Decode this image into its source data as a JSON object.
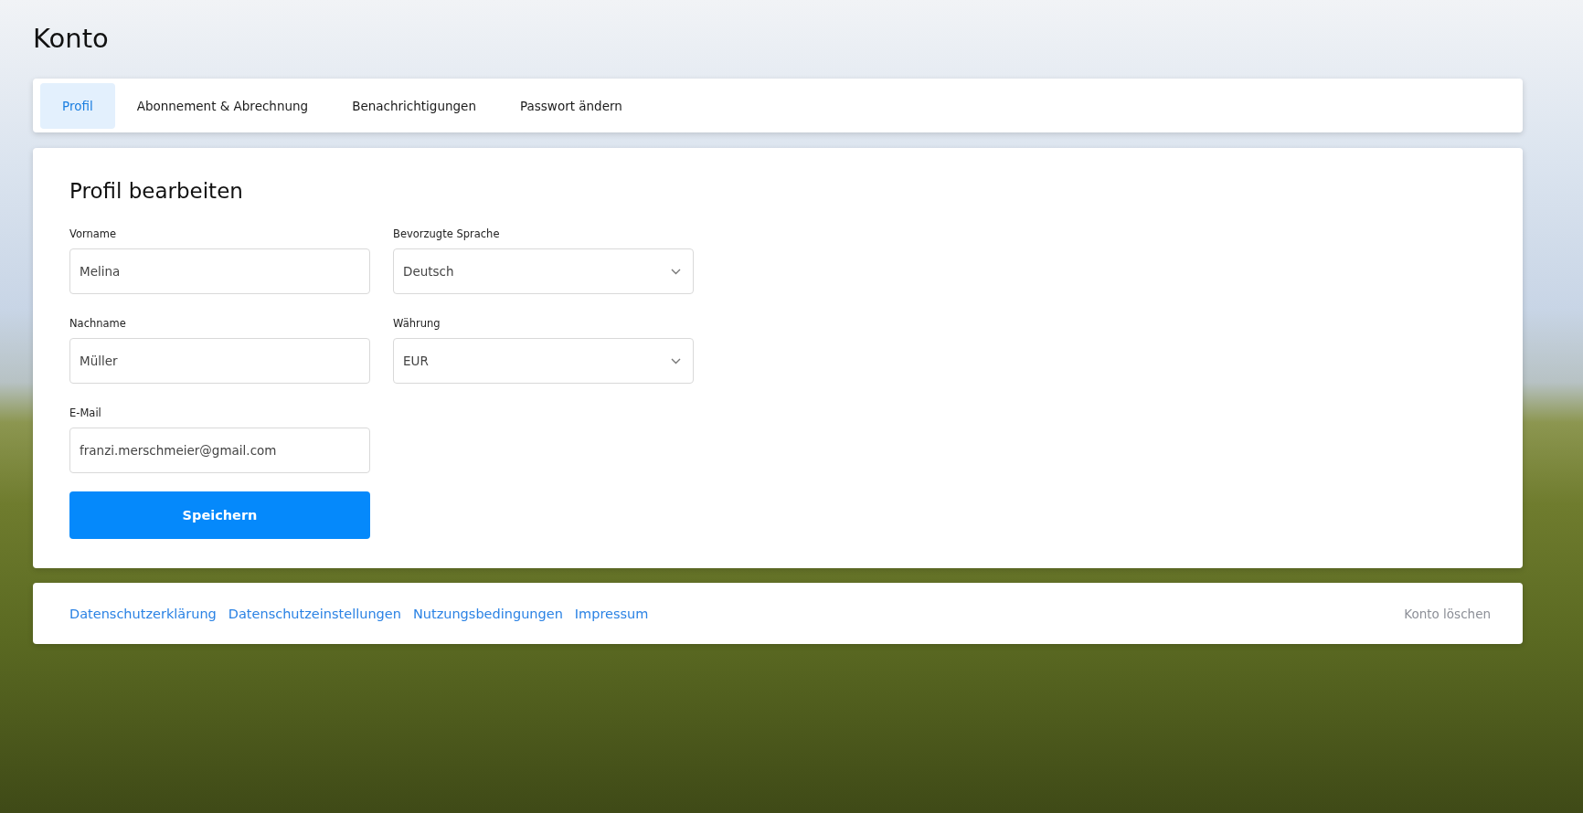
{
  "page": {
    "title": "Konto"
  },
  "tabs": [
    {
      "label": "Profil",
      "selected": true
    },
    {
      "label": "Abonnement & Abrechnung",
      "selected": false
    },
    {
      "label": "Benachrichtigungen",
      "selected": false
    },
    {
      "label": "Passwort ändern",
      "selected": false
    }
  ],
  "profile_form": {
    "title": "Profil bearbeiten",
    "fields": [
      {
        "label": "Vorname",
        "value": "Melina",
        "kind": "text"
      },
      {
        "label": "Bevorzugte Sprache",
        "value": "Deutsch",
        "kind": "select"
      },
      {
        "label": "Nachname",
        "value": "Müller",
        "kind": "text"
      },
      {
        "label": "Währung",
        "value": "EUR",
        "kind": "select"
      },
      {
        "label": "E-Mail",
        "value": "franzi.merschmeier@gmail.com",
        "kind": "text"
      }
    ],
    "save_button": "Speichern"
  },
  "footer": {
    "links": [
      "Datenschutzerklärung",
      "Datenschutzeinstellungen",
      "Nutzungsbedingungen",
      "Impressum"
    ],
    "delete_account": "Konto löschen"
  }
}
